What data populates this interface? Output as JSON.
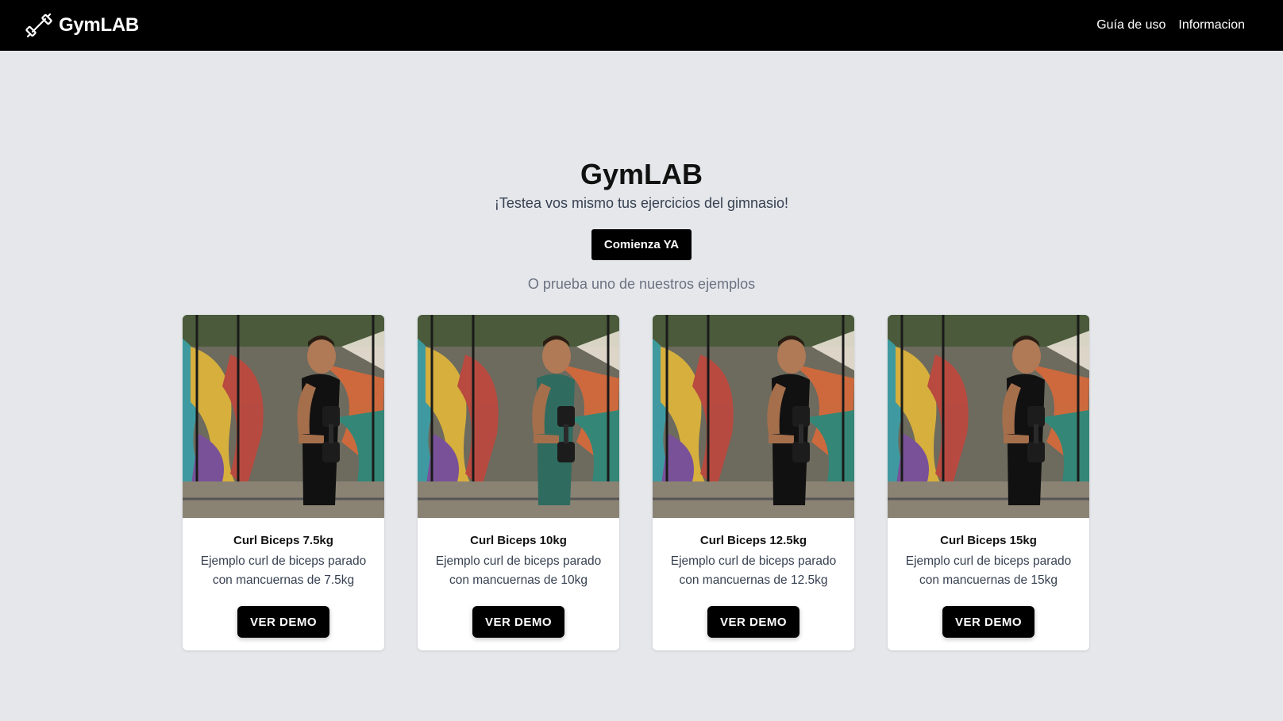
{
  "nav": {
    "brand": "GymLAB",
    "links": [
      "Guía de uso",
      "Informacion"
    ]
  },
  "hero": {
    "title": "GymLAB",
    "subtitle": "¡Testea vos mismo tus ejercicios del gimnasio!",
    "cta_label": "Comienza YA",
    "examples_label": "O prueba uno de nuestros ejemplos"
  },
  "cards": [
    {
      "title": "Curl Biceps 7.5kg",
      "description": "Ejemplo curl de biceps parado con mancuernas de 7.5kg",
      "button": "VER DEMO",
      "shirt_color": "#111111"
    },
    {
      "title": "Curl Biceps 10kg",
      "description": "Ejemplo curl de biceps parado con mancuernas de 10kg",
      "button": "VER DEMO",
      "shirt_color": "#2f6b5e"
    },
    {
      "title": "Curl Biceps 12.5kg",
      "description": "Ejemplo curl de biceps parado con mancuernas de 12.5kg",
      "button": "VER DEMO",
      "shirt_color": "#111111"
    },
    {
      "title": "Curl Biceps 15kg",
      "description": "Ejemplo curl de biceps parado con mancuernas de 15kg",
      "button": "VER DEMO",
      "shirt_color": "#111111"
    }
  ],
  "colors": {
    "navbar": "#000000",
    "background": "#e5e7eb",
    "button": "#000000"
  }
}
